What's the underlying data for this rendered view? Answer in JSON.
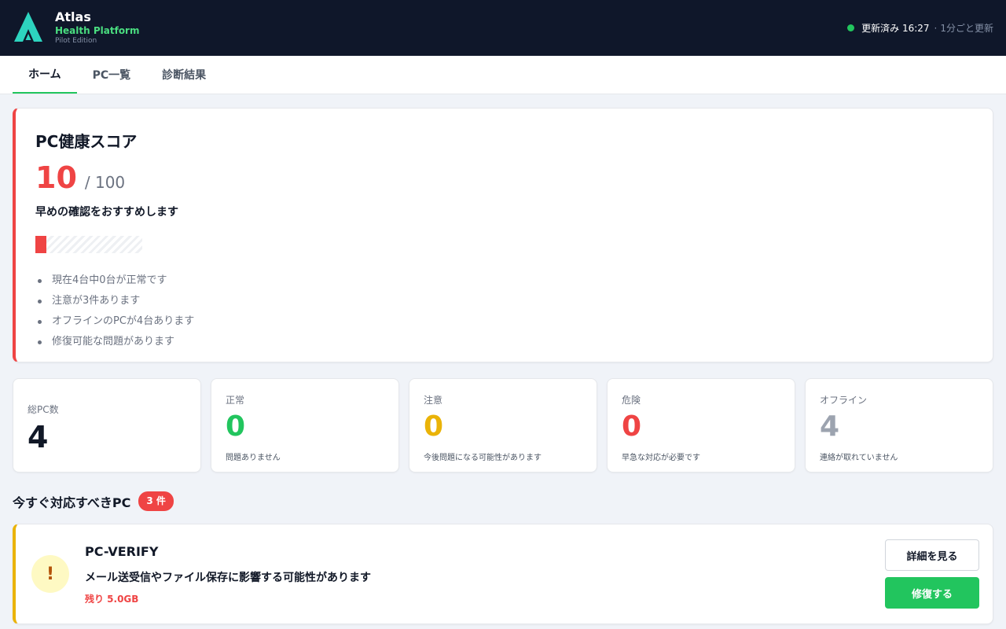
{
  "header": {
    "brand_name": "Atlas",
    "brand_sub": "Health Platform",
    "brand_edition": "Pilot Edition",
    "status_text": "更新済み 16:27",
    "status_separator": "·",
    "status_interval": "1分ごと更新",
    "status_color": "#22c55e"
  },
  "tabs": [
    {
      "label": "ホーム",
      "active": true
    },
    {
      "label": "PC一覧",
      "active": false
    },
    {
      "label": "診断結果",
      "active": false
    }
  ],
  "score": {
    "title": "PC健康スコア",
    "value": "10",
    "max": "/ 100",
    "fill_percent": 10,
    "message": "早めの確認をおすすめします",
    "bullets": [
      "現在4台中0台が正常です",
      "注意が3件あります",
      "オフラインのPCが4台あります",
      "修復可能な問題があります"
    ]
  },
  "stats": [
    {
      "label": "総PC数",
      "value": "4",
      "desc": "",
      "color": "#111827"
    },
    {
      "label": "正常",
      "value": "0",
      "desc": "問題ありません",
      "color": "#22c55e"
    },
    {
      "label": "注意",
      "value": "0",
      "desc": "今後問題になる可能性があります",
      "color": "#eab308"
    },
    {
      "label": "危険",
      "value": "0",
      "desc": "早急な対応が必要です",
      "color": "#ef4444"
    },
    {
      "label": "オフライン",
      "value": "4",
      "desc": "連絡が取れていません",
      "color": "#9ca3af"
    }
  ],
  "section": {
    "title": "今すぐ対応すべきPC",
    "count": "3 件"
  },
  "issue": {
    "icon": "!",
    "name": "PC-VERIFY",
    "description": "メール送受信やファイル保存に影響する可能性があります",
    "remaining": "残り 5.0GB",
    "detail_label": "詳細を見る",
    "fix_label": "修復する"
  }
}
